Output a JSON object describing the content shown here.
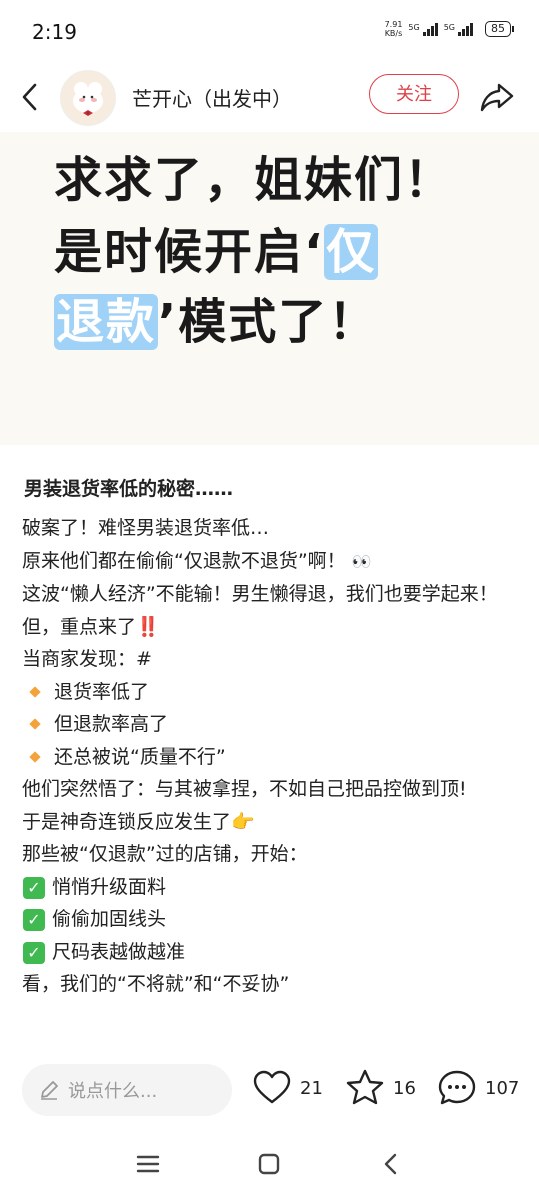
{
  "status_bar": {
    "time": "2:19",
    "net_speed_value": "7.91",
    "net_speed_unit": "KB/s",
    "signal1": "5G",
    "signal2": "5G",
    "battery": "85"
  },
  "header": {
    "author": "芒开心（出发中）",
    "follow_label": "关注"
  },
  "cover": {
    "line1": "求求了，姐妹们！",
    "line2_pre": "是时候开启‘",
    "line2_hl": "仅",
    "line3_hl": "退款",
    "line3_post": "’模式了！"
  },
  "note": {
    "title": "男装退货率低的秘密……",
    "p1": "破案了！难怪男装退货率低…",
    "p2": "原来他们都在偷偷“仅退款不退货”啊！",
    "p2_emoji": "👀",
    "p3": "这波“懒人经济”不能输！男生懒得退，我们也要学起来！",
    "p4": "但，重点来了",
    "p4_emoji": "‼️",
    "p5": "当商家发现：#",
    "bullets": [
      "退货率低了",
      "但退款率高了",
      "还总被说“质量不行”"
    ],
    "p6": "他们突然悟了：与其被拿捏，不如自己把品控做到顶!",
    "p7": "于是神奇连锁反应发生了",
    "p7_emoji": "👉",
    "p8": "那些被“仅退款”过的店铺，开始：",
    "checks": [
      "悄悄升级面料",
      "偷偷加固线头",
      "尺码表越做越准"
    ],
    "p9": "看，我们的“不将就”和“不妥协”"
  },
  "actions": {
    "comment_placeholder": "说点什么...",
    "likes": "21",
    "collects": "16",
    "comments": "107"
  },
  "colors": {
    "accent": "#e0404a",
    "highlight": "#9fd2f6",
    "check": "#3fb950",
    "bullet": "#f4a33a"
  }
}
